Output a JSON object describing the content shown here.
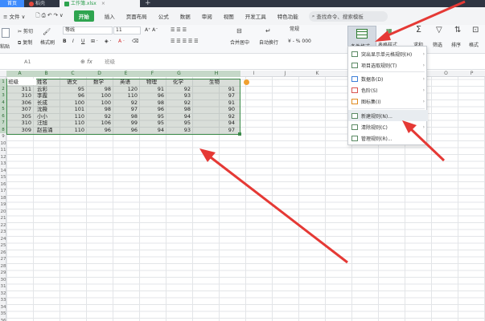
{
  "titlebar": {
    "tabs": [
      {
        "label": "首页",
        "type": "home"
      },
      {
        "label": "稻壳",
        "type": "docer"
      },
      {
        "label": "工作簿.xlsx",
        "type": "active"
      }
    ],
    "new_tab": "+"
  },
  "menubar": {
    "hamburger": "≡ 文件 ∨",
    "start": "开始",
    "items": [
      "插入",
      "页面布局",
      "公式",
      "数据",
      "审阅",
      "视图",
      "开发工具",
      "特色功能"
    ],
    "search_placeholder": "查找命令、搜索模板"
  },
  "ribbon": {
    "cut": "剪切",
    "paste": "粘贴",
    "copy": "复制",
    "format_painter": "格式刷",
    "font_name": "等线",
    "font_size": "11",
    "merge_center": "合并居中",
    "wrap": "自动换行",
    "number_format": "常规",
    "percent": "¥ - % 000",
    "cond_format": "条件格式",
    "table_style": "表格样式",
    "sum": "求和",
    "filter": "筛选",
    "sort": "排序",
    "format": "格式"
  },
  "formula_bar": {
    "cell_ref": "A1",
    "fx": "fx",
    "value": "班级"
  },
  "sheet": {
    "columns": [
      "A",
      "B",
      "C",
      "D",
      "E",
      "F",
      "G",
      "H",
      "I",
      "J",
      "K",
      "L",
      "M",
      "N",
      "O",
      "P",
      "Q",
      "R"
    ],
    "header": [
      "班级",
      "姓名",
      "语文",
      "数学",
      "英语",
      "物理",
      "化学",
      "生物"
    ],
    "rows": [
      [
        "311",
        "云彩",
        "95",
        "98",
        "120",
        "91",
        "92",
        "91"
      ],
      [
        "310",
        "李霞",
        "96",
        "100",
        "110",
        "96",
        "93",
        "97"
      ],
      [
        "306",
        "长成",
        "100",
        "100",
        "92",
        "98",
        "92",
        "91"
      ],
      [
        "307",
        "沈薇",
        "101",
        "98",
        "97",
        "96",
        "98",
        "90"
      ],
      [
        "305",
        "小小",
        "110",
        "92",
        "98",
        "95",
        "94",
        "92"
      ],
      [
        "310",
        "汪旭",
        "110",
        "106",
        "99",
        "95",
        "95",
        "94"
      ],
      [
        "309",
        "赵芸涌",
        "110",
        "96",
        "96",
        "94",
        "93",
        "97"
      ]
    ]
  },
  "cond_menu": {
    "items": [
      {
        "label": "突出显示单元格规则(H)",
        "submenu": true
      },
      {
        "label": "项目选取规则(T)",
        "submenu": true
      },
      {
        "label": "数据条(D)",
        "submenu": true
      },
      {
        "label": "色阶(S)",
        "submenu": true
      },
      {
        "label": "图标集(I)",
        "submenu": true
      },
      {
        "label": "新建规则(N)...",
        "submenu": false
      },
      {
        "label": "清除规则(C)",
        "submenu": true
      },
      {
        "label": "管理规则(R)...",
        "submenu": false
      }
    ]
  },
  "colors": {
    "accent_green": "#2ea44f",
    "arrow_red": "#e53935",
    "selection_border": "#3c8b4a"
  }
}
